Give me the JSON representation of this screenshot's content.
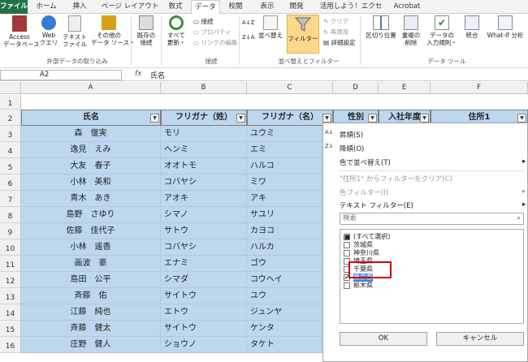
{
  "tabs": [
    "ファイル",
    "ホーム",
    "挿入",
    "ページ レイアウト",
    "数式",
    "データ",
    "校閲",
    "表示",
    "開発",
    "活用しよう！エクセル",
    "Acrobat"
  ],
  "ribbon": {
    "access": "Access\nデータベース",
    "web": "Web\nクエリ",
    "text": "テキスト\nファイル",
    "other": "その他の\nデータ ソース・",
    "existing": "既存の\n接続",
    "refresh": "すべて\n更新・",
    "conn": "接続",
    "prop": "プロパティ",
    "links": "リンクの編集",
    "sort": "並べ替え",
    "filter": "フィルター",
    "clear": "クリア",
    "reapply": "再適用",
    "advanced": "詳細設定",
    "split": "区切り位置",
    "dedupe": "重複の\n削除",
    "validation": "データの\n入力規則・",
    "consolidate": "統合",
    "whatif": "What-If 分析",
    "g_ext": "外部データの取り込み",
    "g_conn": "接続",
    "g_sort": "並べ替えとフィルター",
    "g_tools": "データ ツール"
  },
  "formula": {
    "name": "A2",
    "fx": "fx",
    "value": "氏名"
  },
  "columns": [
    "A",
    "B",
    "C",
    "D",
    "E",
    "F"
  ],
  "rows": [
    "1",
    "2",
    "3",
    "4",
    "5",
    "6",
    "7",
    "8",
    "9",
    "10",
    "11",
    "12",
    "13",
    "14",
    "15",
    "16"
  ],
  "headers": [
    "氏名",
    "フリガナ（姓）",
    "フリガナ（名）",
    "性別",
    "入社年度",
    "住所1"
  ],
  "data": [
    [
      "森　偃実",
      "モリ",
      "ユウミ"
    ],
    [
      "逸見　えみ",
      "ヘンミ",
      "エミ"
    ],
    [
      "大友　春子",
      "オオトモ",
      "ハルコ"
    ],
    [
      "小林　美和",
      "コバヤシ",
      "ミワ"
    ],
    [
      "青木　あき",
      "アオキ",
      "アキ"
    ],
    [
      "島野　さゆり",
      "シマノ",
      "サユリ"
    ],
    [
      "佐藤　佳代子",
      "サトウ",
      "カヨコ"
    ],
    [
      "小林　遥香",
      "コバヤシ",
      "ハルカ"
    ],
    [
      "画波　豪",
      "エナミ",
      "ゴウ"
    ],
    [
      "島田　公平",
      "シマダ",
      "コウヘイ"
    ],
    [
      "斉藤　佑",
      "サイトウ",
      "ユウ"
    ],
    [
      "江藤　純也",
      "エトウ",
      "ジュンヤ"
    ],
    [
      "斉藤　健太",
      "サイトウ",
      "ケンタ"
    ],
    [
      "庄野　健人",
      "ショウノ",
      "タケト"
    ]
  ],
  "menu": {
    "asc": "昇順(S)",
    "desc": "降順(O)",
    "color_sort": "色で並べ替え(T)",
    "clear": "\"住所1\" からフィルターをクリア(C)",
    "color_filter": "色フィルター(I)",
    "text_filter": "テキスト フィルター(E)",
    "search": "検索",
    "items": [
      {
        "label": "(すべて選択)",
        "state": "■"
      },
      {
        "label": "茨城県",
        "state": ""
      },
      {
        "label": "神奈川県",
        "state": ""
      },
      {
        "label": "埼玉県",
        "state": ""
      },
      {
        "label": "千葉県",
        "state": ""
      },
      {
        "label": "東京都",
        "state": "✔"
      },
      {
        "label": "栃木県",
        "state": ""
      }
    ],
    "ok": "OK",
    "cancel": "キャンセル"
  },
  "colors": {
    "accent": "#217346",
    "cell": "#bcd7ee",
    "highlight": "#d0000c"
  }
}
